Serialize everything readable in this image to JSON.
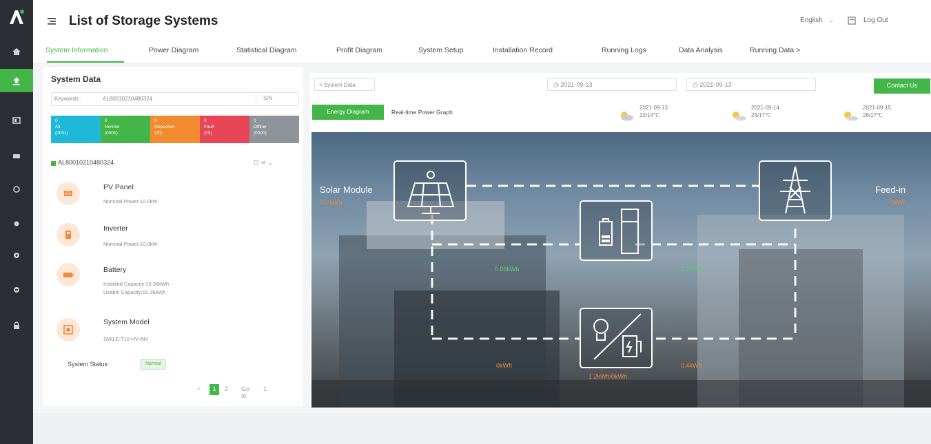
{
  "app": {
    "title": "List of Storage Systems",
    "language": "English",
    "logout_label": "Log Out"
  },
  "colors": {
    "accent": "#44b649",
    "rail": "#2b2f33",
    "status_all": "#1fb8d6",
    "status_normal": "#44b649",
    "status_inspection": "#f28b30",
    "status_fault": "#e84656",
    "status_offline": "#8e9499",
    "value_orange": "#f08a3c",
    "value_green": "#5fd35a"
  },
  "rail": {
    "items": [
      {
        "icon": "home-icon",
        "active": false
      },
      {
        "icon": "storage-system-icon",
        "active": true
      },
      {
        "icon": "device-icon",
        "active": false
      },
      {
        "icon": "monitor-icon",
        "active": false
      },
      {
        "icon": "alarm-icon",
        "active": false
      },
      {
        "icon": "report-icon",
        "active": false
      },
      {
        "icon": "settings-icon",
        "active": false
      },
      {
        "icon": "user-icon",
        "active": false
      },
      {
        "icon": "lock-icon",
        "active": false
      }
    ]
  },
  "tabs": [
    {
      "label": "System Information",
      "active": true
    },
    {
      "label": "Power Diagram"
    },
    {
      "label": "Statistical Diagram"
    },
    {
      "label": "Profit Diagram"
    },
    {
      "label": "System Setup"
    },
    {
      "label": "Installation Record"
    },
    {
      "label": "Running Logs"
    },
    {
      "label": "Data Analysis"
    },
    {
      "label": "Running Data >"
    }
  ],
  "left_panel": {
    "title": "System Data",
    "search_label": "Keywords :",
    "search_value": "AL80010210480324",
    "search_select": "S/N",
    "statuses": [
      {
        "count": "0",
        "label": "All",
        "sub": "(0001)"
      },
      {
        "count": "0",
        "label": "Normal",
        "sub": "(0001)"
      },
      {
        "count": "0",
        "label": "Inspection",
        "sub": "(00)"
      },
      {
        "count": "0",
        "label": "Fault",
        "sub": "(00)"
      },
      {
        "count": "0",
        "label": "Offline",
        "sub": "(0000)"
      }
    ],
    "device_id": "AL80010210480324",
    "device_actions": "⊡ ⋖ ⌄",
    "components": [
      {
        "icon": "pv-panel-icon",
        "title": "PV Panel",
        "lines": [
          "Nominal Power:10.0kW"
        ]
      },
      {
        "icon": "inverter-icon",
        "title": "Inverter",
        "lines": [
          "Nominal Power:10.0kW"
        ]
      },
      {
        "icon": "battery-icon",
        "title": "Battery",
        "lines": [
          "Installed Capacity:15.36kWh",
          "Usable Capacity:15.36kWh"
        ]
      },
      {
        "icon": "system-model-icon",
        "title": "System Model",
        "lines": [
          "SMILE-T10-HV-INV"
        ]
      }
    ],
    "system_status_label": "System Status :",
    "system_status_value": "Normal",
    "pager": {
      "prev": "<",
      "current": "1",
      "next": "2",
      "goto_label": "Go to",
      "goto_value": "1"
    }
  },
  "right_panel": {
    "breadcrumb": "< System Data",
    "date_from": "2021-09-13",
    "date_to": "2021-09-13",
    "contact_button": "Contact Us",
    "subtab_active": "Energy Diagram",
    "subtab_other": "Real-time Power Graph",
    "weather": [
      {
        "date": "2021-09-13",
        "temp": "22/14℃",
        "icon": "cloudy-icon"
      },
      {
        "date": "2021-09-14",
        "temp": "24/17℃",
        "icon": "partly-sunny-icon"
      },
      {
        "date": "2021-09-15",
        "temp": "26/17℃",
        "icon": "partly-sunny-icon"
      }
    ]
  },
  "diagram": {
    "solar_label": "Solar Module",
    "solar_value": "0.7kWh",
    "feedin_label": "Feed-in",
    "feedin_value": "0kWh",
    "flow_solar_battery": "0.06kWh",
    "flow_battery_grid": "0.11kWh",
    "flow_solar_load": "0kWh",
    "flow_grid_load": "0.4kWh",
    "load_value": "1.2kWh/0kWh"
  }
}
